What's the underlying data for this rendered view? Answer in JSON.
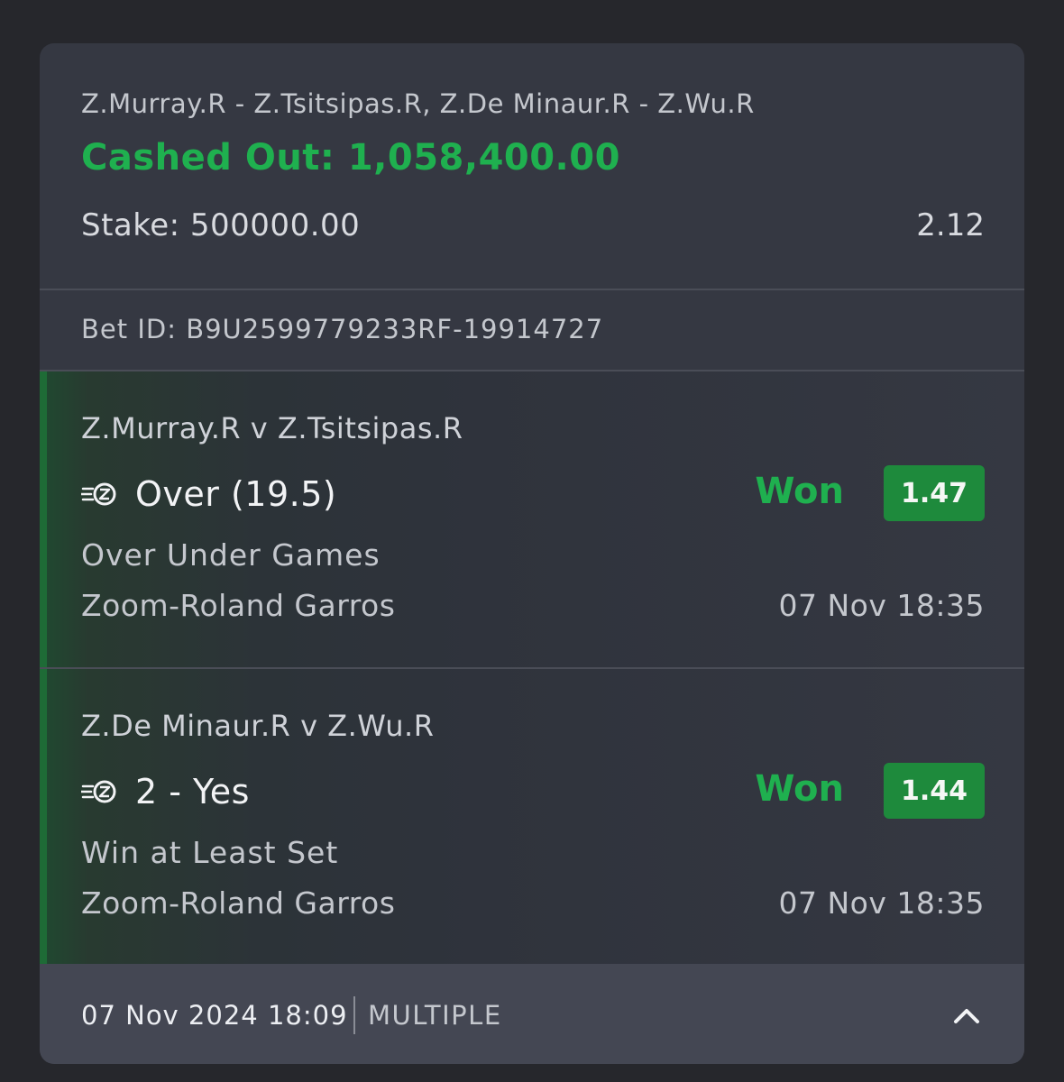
{
  "bet": {
    "matches": "Z.Murray.R - Z.Tsitsipas.R, Z.De Minaur.R - Z.Wu.R",
    "cashed_out": "Cashed Out: 1,058,400.00",
    "stake": "Stake: 500000.00",
    "total_odds": "2.12",
    "bet_id": "Bet ID: B9U2599779233RF-19914727"
  },
  "legs": [
    {
      "match": "Z.Murray.R v Z.Tsitsipas.R",
      "pick": "Over (19.5)",
      "status": "Won",
      "odds": "1.47",
      "market": "Over Under Games",
      "tournament": "Zoom-Roland Garros",
      "time": "07 Nov 18:35",
      "icon": "zoom-icon"
    },
    {
      "match": "Z.De Minaur.R v Z.Wu.R",
      "pick": "2 - Yes",
      "status": "Won",
      "odds": "1.44",
      "market": "Win at Least Set",
      "tournament": "Zoom-Roland Garros",
      "time": "07 Nov 18:35",
      "icon": "zoom-icon"
    }
  ],
  "footer": {
    "placed": "07 Nov 2024 18:09",
    "type": "MULTIPLE",
    "toggle_icon": "chevron-up-icon"
  },
  "colors": {
    "won": "#1fb04f",
    "badge": "#1e8a3c",
    "card": "#353842",
    "background": "#26272c"
  }
}
